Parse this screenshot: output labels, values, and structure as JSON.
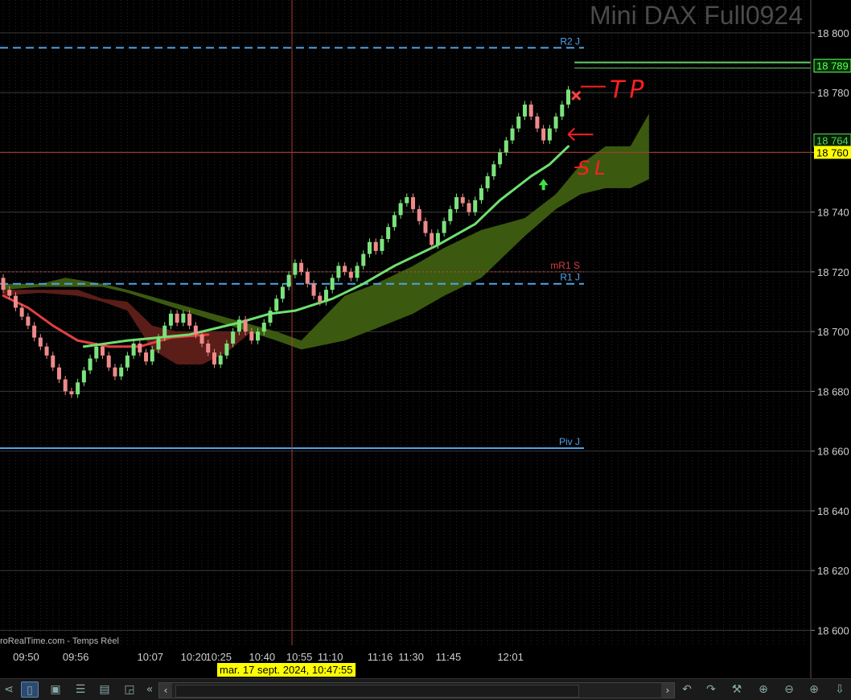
{
  "title": "Mini DAX Full0924",
  "source_label": "roRealTime.com - Temps Réel",
  "crosshair_date": "mar. 17 sept. 2024, 10:47:55",
  "chart_data": {
    "type": "candlestick",
    "instrument": "Mini DAX Full0924",
    "ylim": [
      18595,
      18811
    ],
    "y_ticks": [
      {
        "value": 18800,
        "label": "18 800"
      },
      {
        "value": 18780,
        "label": "18 780"
      },
      {
        "value": 18760,
        "label": "18 760"
      },
      {
        "value": 18740,
        "label": "18 740"
      },
      {
        "value": 18720,
        "label": "18 720"
      },
      {
        "value": 18700,
        "label": "18 700"
      },
      {
        "value": 18680,
        "label": "18 680"
      },
      {
        "value": 18660,
        "label": "18 660"
      },
      {
        "value": 18640,
        "label": "18 640"
      },
      {
        "value": 18620,
        "label": "18 620"
      },
      {
        "value": 18600,
        "label": "18 600"
      }
    ],
    "x_labels": [
      "09:50",
      "09:56",
      "10:07",
      "10:20",
      "10:25",
      "10:40",
      "10:55",
      "11:10",
      "11:16",
      "11:30",
      "11:45",
      "12:01"
    ],
    "x_label_bars": [
      2,
      10,
      22,
      29,
      33,
      40,
      46,
      51,
      59,
      64,
      70,
      80
    ],
    "bar_count": 92,
    "closes": [
      18714,
      18712,
      18708,
      18705,
      18702,
      18698,
      18695,
      18692,
      18688,
      18684,
      18680,
      18679,
      18683,
      18687,
      18691,
      18695,
      18692,
      18688,
      18685,
      18688,
      18692,
      18696,
      18693,
      18690,
      18694,
      18698,
      18702,
      18706,
      18703,
      18706,
      18702,
      18699,
      18696,
      18693,
      18689,
      18692,
      18696,
      18700,
      18704,
      18700,
      18697,
      18700,
      18703,
      18707,
      18711,
      18715,
      18719,
      18723,
      18720,
      18716,
      18712,
      18710,
      18714,
      18718,
      18722,
      18720,
      18718,
      18722,
      18726,
      18730,
      18727,
      18731,
      18735,
      18739,
      18743,
      18745,
      18741,
      18737,
      18733,
      18729,
      18733,
      18737,
      18741,
      18745,
      18743,
      18740,
      18744,
      18748,
      18752,
      18756,
      18760,
      18764,
      18768,
      18772,
      18776,
      18772,
      18768,
      18764,
      18768,
      18772,
      18776,
      18781
    ],
    "moving_average_green": [
      [
        13,
        18695
      ],
      [
        20,
        18697
      ],
      [
        30,
        18699
      ],
      [
        38,
        18703
      ],
      [
        43,
        18706
      ],
      [
        47,
        18707
      ],
      [
        53,
        18711
      ],
      [
        58,
        18716
      ],
      [
        63,
        18722
      ],
      [
        66,
        18725
      ],
      [
        70,
        18729
      ],
      [
        76,
        18736
      ],
      [
        80,
        18744
      ],
      [
        85,
        18752
      ],
      [
        88,
        18756
      ],
      [
        91,
        18762
      ]
    ],
    "moving_average_red": [
      [
        0,
        18712
      ],
      [
        4,
        18708
      ],
      [
        8,
        18702
      ],
      [
        12,
        18697
      ],
      [
        17,
        18695
      ],
      [
        22,
        18695
      ],
      [
        27,
        18698
      ],
      [
        33,
        18699
      ]
    ],
    "cloud_red": {
      "top": [
        [
          0,
          18714
        ],
        [
          6,
          18714
        ],
        [
          12,
          18714
        ],
        [
          16,
          18711
        ],
        [
          20,
          18710
        ],
        [
          24,
          18702
        ],
        [
          28,
          18700
        ],
        [
          32,
          18700
        ],
        [
          36,
          18700
        ],
        [
          40,
          18700
        ],
        [
          44,
          18700
        ]
      ],
      "bottom": [
        [
          0,
          18712
        ],
        [
          6,
          18713
        ],
        [
          12,
          18712
        ],
        [
          16,
          18710
        ],
        [
          20,
          18707
        ],
        [
          24,
          18694
        ],
        [
          28,
          18689
        ],
        [
          32,
          18689
        ],
        [
          36,
          18693
        ],
        [
          40,
          18700
        ],
        [
          44,
          18700
        ]
      ]
    },
    "cloud_green": {
      "top": [
        [
          0,
          18716
        ],
        [
          6,
          18716
        ],
        [
          10,
          18718
        ],
        [
          16,
          18716
        ],
        [
          20,
          18714
        ],
        [
          44,
          18700
        ],
        [
          48,
          18697
        ],
        [
          55,
          18712
        ],
        [
          60,
          18716
        ],
        [
          66,
          18722
        ],
        [
          71,
          18728
        ],
        [
          77,
          18734
        ],
        [
          84,
          18738
        ],
        [
          89,
          18746
        ],
        [
          93,
          18756
        ],
        [
          97,
          18762
        ],
        [
          101,
          18762
        ],
        [
          104,
          18773
        ]
      ],
      "bottom": [
        [
          0,
          18714
        ],
        [
          6,
          18715
        ],
        [
          10,
          18715
        ],
        [
          16,
          18715
        ],
        [
          20,
          18713
        ],
        [
          44,
          18697
        ],
        [
          48,
          18694
        ],
        [
          55,
          18697
        ],
        [
          60,
          18701
        ],
        [
          66,
          18706
        ],
        [
          71,
          18712
        ],
        [
          77,
          18718
        ],
        [
          84,
          18732
        ],
        [
          89,
          18741
        ],
        [
          93,
          18746
        ],
        [
          97,
          18748
        ],
        [
          101,
          18748
        ],
        [
          104,
          18751
        ]
      ]
    },
    "horizontal_levels": [
      {
        "name": "R2 J",
        "value": 18795,
        "style": "dashed",
        "color": "#4fa3e8"
      },
      {
        "name": "mR1 S",
        "value": 18720,
        "style": "dotted",
        "color": "#d04040"
      },
      {
        "name": "R1 J",
        "value": 18716,
        "style": "dashed",
        "color": "#4fa3e8"
      },
      {
        "name": "Piv J",
        "value": 18661,
        "style": "solid",
        "color": "#4fa3e8"
      }
    ],
    "price_markers": [
      {
        "label": "18 789",
        "value": 18789,
        "color": "#66ff66",
        "background": "#003300"
      },
      {
        "label": "18 764",
        "value": 18764,
        "color": "#66cc66",
        "background": "#002200"
      },
      {
        "label": "18 760",
        "value": 18760,
        "color": "#000000",
        "background": "#ffff00"
      }
    ],
    "annotations": [
      {
        "text": "TP",
        "near_value": 18781,
        "color": "#ff2020"
      },
      {
        "text": "SL",
        "near_value": 18755,
        "color": "#ff2020"
      }
    ],
    "colors": {
      "up_candle": "#7de37d",
      "down_candle": "#ef8a8a",
      "grid": "#262626",
      "crosshair": "#b03a2e"
    }
  }
}
